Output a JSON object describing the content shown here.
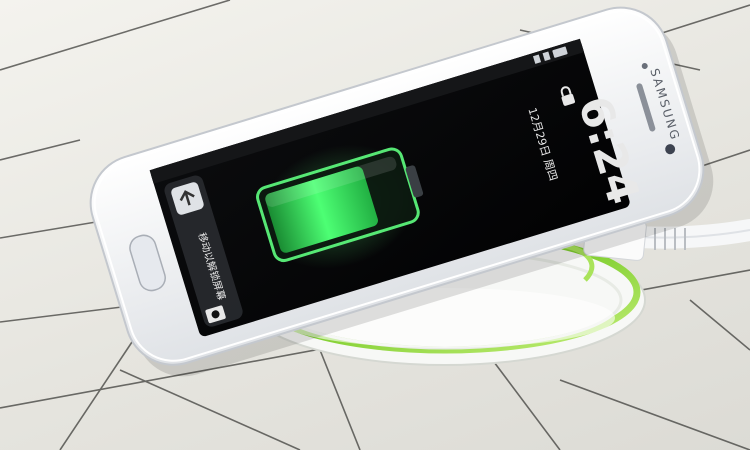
{
  "phone": {
    "brand": "SAMSUNG",
    "lockscreen": {
      "time": "6:24",
      "date": "12月29日 周四",
      "unlock_hint": "移动以解锁屏幕"
    },
    "battery_level": 0.75
  },
  "colors": {
    "charger_glow": "#8fd43a",
    "battery_green": "#3cff6a",
    "phone_body": "#f5f6f8",
    "screen": "#050607"
  },
  "icons": [
    "lock-icon",
    "camera-icon",
    "unlock-arrow-icon",
    "status-bar-icons"
  ]
}
